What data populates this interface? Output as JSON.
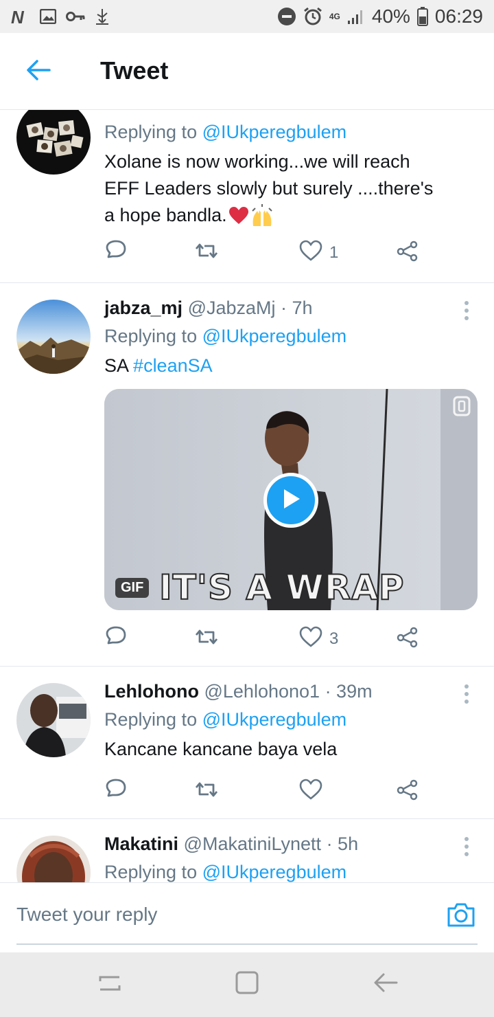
{
  "status_bar": {
    "icons_left": [
      "netflix-n-icon",
      "gallery-icon",
      "key-icon",
      "usb-icon"
    ],
    "icons_right": [
      "do-not-disturb-icon",
      "alarm-icon",
      "network-4g-icon",
      "signal-icon",
      "battery-icon"
    ],
    "network": "4G",
    "battery": "40%",
    "time": "06:29"
  },
  "header": {
    "title": "Tweet",
    "back_icon": "arrow-left-icon"
  },
  "colors": {
    "accent": "#1da1f2",
    "text": "#14171a",
    "secondary": "#657786",
    "divider": "#e1e8ed",
    "heart": "#e0245e"
  },
  "tweets": [
    {
      "replying_prefix": "Replying to",
      "replying_to": "@IUkperegbulem",
      "text_lines": [
        "Xolane is now working...we will reach",
        "EFF Leaders slowly but surely ....there's",
        "a hope bandla."
      ],
      "emojis": [
        "red-heart-icon",
        "raising-hands-icon"
      ],
      "likes": "1"
    },
    {
      "name": "jabza_mj",
      "handle": "@JabzaMj",
      "time": "· 7h",
      "replying_prefix": "Replying to",
      "replying_to": "@IUkperegbulem",
      "text": "SA",
      "hashtag": "#cleanSA",
      "media": {
        "badge": "GIF",
        "caption": "IT'S A WRAP"
      },
      "likes": "3"
    },
    {
      "name": "Lehlohono",
      "handle": "@Lehlohono1",
      "time": "· 39m",
      "replying_prefix": "Replying to",
      "replying_to": "@IUkperegbulem",
      "text": "Kancane kancane baya vela",
      "likes": ""
    },
    {
      "name": "Makatini",
      "handle": "@MakatiniLynett",
      "time": "· 5h",
      "replying_prefix": "Replying to",
      "replying_to": "@IUkperegbulem"
    }
  ],
  "reply_bar": {
    "placeholder": "Tweet your reply",
    "camera_icon": "camera-icon"
  },
  "nav_bar": {
    "icons": [
      "recents-icon",
      "home-icon",
      "back-icon"
    ]
  }
}
